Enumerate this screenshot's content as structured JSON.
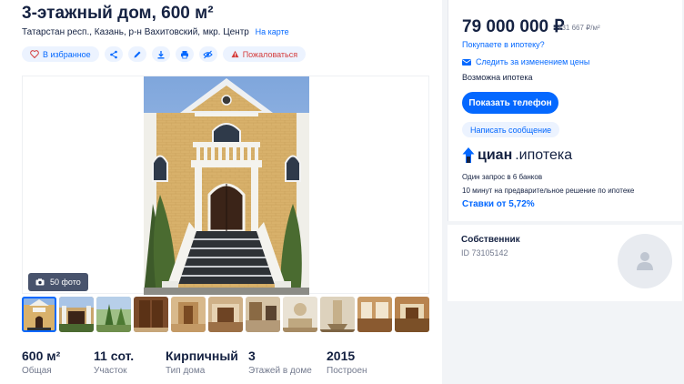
{
  "listing": {
    "title": "3-этажный дом, 600 м²",
    "address": "Татарстан респ., Казань, р-н Вахитовский, мкр. Центр",
    "map_link": "На карте"
  },
  "actions": {
    "favorite": "В избранное",
    "complain": "Пожаловаться"
  },
  "gallery": {
    "photo_count": "50 фото",
    "thumb_count": 11
  },
  "facts": [
    {
      "value": "600 м²",
      "label": "Общая"
    },
    {
      "value": "11 сот.",
      "label": "Участок"
    },
    {
      "value": "Кирпичный",
      "label": "Тип дома"
    },
    {
      "value": "3",
      "label": "Этажей в доме"
    },
    {
      "value": "2015",
      "label": "Построен"
    }
  ],
  "sidebar": {
    "price": "79 000 000 ₽",
    "price_per_m": "131 667 ₽/м²",
    "mortgage_link": "Покупаете в ипотеку?",
    "watch_price": "Следить за изменением цены",
    "mortgage_possible": "Возможна ипотека",
    "show_phone": "Показать телефон",
    "write_message": "Написать сообщение",
    "brand": "циан",
    "brand_sub": ".ипотека",
    "mortgage_line1": "Один запрос в 6 банков",
    "mortgage_line2": "10 минут на предварительное решение по ипотеке",
    "rates": "Ставки от 5,72%"
  },
  "owner": {
    "title": "Собственник",
    "id": "ID 73105142"
  },
  "colors": {
    "accent": "#0468ff",
    "text": "#152242",
    "muted": "#737a8e",
    "danger": "#d43c3c"
  }
}
